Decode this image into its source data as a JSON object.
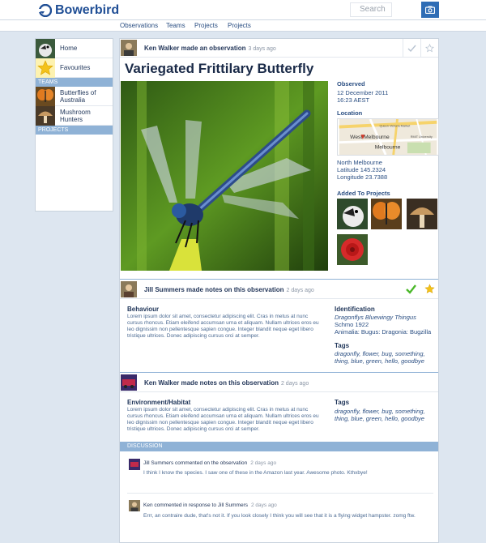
{
  "app": {
    "name": "Bowerbird"
  },
  "search": {
    "placeholder": "Search"
  },
  "nav": [
    "Observations",
    "Teams",
    "Projects",
    "Projects"
  ],
  "sidebar": {
    "items": [
      {
        "label": "Home"
      },
      {
        "label": "Favourites"
      }
    ],
    "teams_header": "TEAMS",
    "teams": [
      {
        "label": "Butterflies of Australia"
      },
      {
        "label": "Mushroom Hunters"
      }
    ],
    "projects_header": "PROJECTS"
  },
  "observation": {
    "author_line": "Ken Walker made an observation",
    "time": "3 days ago",
    "title": "Variegated Frittilary Butterfly",
    "observed_label": "Observed",
    "observed_date": "12 December 2011",
    "observed_time": "16:23 AEST",
    "location_label": "Location",
    "location_name": "North Melbourne",
    "latitude": "Latitude 145.2324",
    "longitude": "Longitude 23.7388",
    "map_labels": [
      "West Melbourne",
      "Melbourne",
      "Queen Victoria Market",
      "RMIT University"
    ],
    "projects_label": "Added To Projects"
  },
  "note1": {
    "author_line": "Jill Summers made notes on this observation",
    "time": "2 days ago",
    "section_title": "Behaviour",
    "text": "Lorem ipsum dolor sit amet, consectetur adipiscing elit. Cras in metus at nunc cursus rhoncus. Etiam eleifend accumsan urna et aliquam. Nullam ultrices eros eu leo dignissim non pellentesque sapien congue. Integer blandit neque eget libero tristique ultrices. Donec adipiscing cursus orci at semper.",
    "identification_label": "Identification",
    "species": "Dragonflys Bluewingy Thingus",
    "species_author": "Schmo 1922",
    "taxonomy": "Animalia: Bugus: Dragonia: Bugzilla",
    "tags_label": "Tags",
    "tags_line1": "dragonfly, flower, bug, something,",
    "tags_line2": "thing, blue, green, hello, goodbye"
  },
  "note2": {
    "author_line": "Ken Walker made notes on this observation",
    "time": "2 days ago",
    "section_title": "Environment/Habitat",
    "text": "Lorem ipsum dolor sit amet, consectetur adipiscing elit. Cras in metus at nunc cursus rhoncus. Etiam eleifend accumsan urna et aliquam. Nullam ultrices eros eu leo dignissim non pellentesque sapien congue. Integer blandit neque eget libero tristique ultrices. Donec adipiscing cursus orci at semper.",
    "tags_label": "Tags",
    "tags_line1": "dragonfly, flower, bug, something,",
    "tags_line2": "thing, blue, green, hello, goodbye"
  },
  "discussion": {
    "header": "DISCUSSION",
    "comments": [
      {
        "name": "Jill Summers commented on the observation",
        "time": "2 days ago",
        "text": "I think I know the species. I saw one of these in the Amazon last year. Awesome photo. Kthxbye!"
      },
      {
        "name": "Ken commented in response to Jill Summers",
        "time": "2 days ago",
        "text": "Errr, an contraire dude, that's not it. If you look closely I think you will see that it is a flying widget hampster. zomg ftw."
      }
    ]
  },
  "colors": {
    "brand": "#1f4e95",
    "accent": "#8fb2d6",
    "page_bg": "#dde6f0"
  }
}
